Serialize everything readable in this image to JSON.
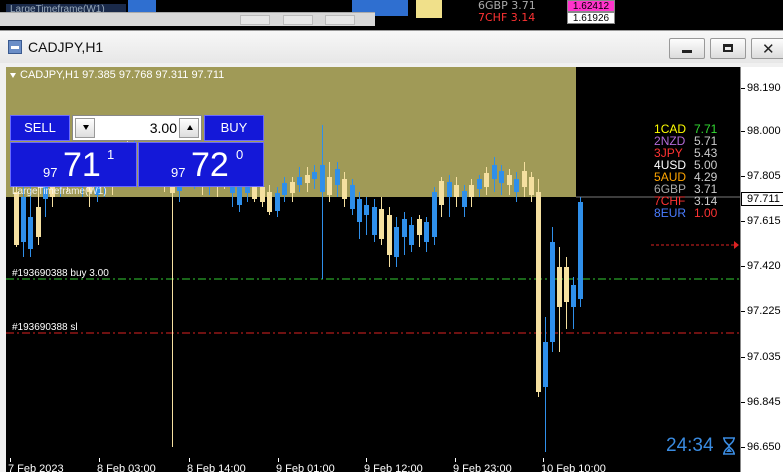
{
  "background_window": {
    "title_fragment": "LargeTimeframe(W1)",
    "rows": [
      {
        "text": "6GBP 3.71"
      },
      {
        "text": "7CHF 3.14"
      }
    ],
    "price_top": "1.62412",
    "price_bottom": "1.61926"
  },
  "window": {
    "title": "CADJPY,H1",
    "buttons": {
      "minimize": "",
      "maximize": "",
      "close": "✕"
    }
  },
  "chart": {
    "symbol_info": "CADJPY,H1  97.385 97.768 97.311 97.711",
    "indicator_label": "LargeTimeframe(W1)",
    "current_price": "97.711",
    "y_ticks": [
      "98.190",
      "98.000",
      "97.805",
      "97.615",
      "97.420",
      "97.225",
      "97.035",
      "96.845",
      "96.650"
    ],
    "x_labels": [
      "7 Feb 2023",
      "8 Feb 03:00",
      "8 Feb 14:00",
      "9 Feb 01:00",
      "9 Feb 12:00",
      "9 Feb 23:00",
      "10 Feb 10:00"
    ],
    "orders": [
      {
        "label": "#193690388 buy 3.00"
      },
      {
        "label": "#193690388 sl"
      }
    ],
    "timer": "24:34"
  },
  "one_click": {
    "sell_label": "SELL",
    "buy_label": "BUY",
    "lot": "3.00",
    "sell": {
      "prefix": "97",
      "big": "71",
      "sup": "1"
    },
    "buy": {
      "prefix": "97",
      "big": "72",
      "sup": "0"
    }
  },
  "strength": [
    {
      "rank": "1",
      "cur": "CAD",
      "val": "7.71",
      "cur_color": "#ffff00",
      "val_color": "#33dd33"
    },
    {
      "rank": "2",
      "cur": "NZD",
      "val": "5.71",
      "cur_color": "#b36bd8",
      "val_color": "#cccccc"
    },
    {
      "rank": "3",
      "cur": "JPY",
      "val": "5.43",
      "cur_color": "#ff3333",
      "val_color": "#cccccc"
    },
    {
      "rank": "4",
      "cur": "USD",
      "val": "5.00",
      "cur_color": "#ffffff",
      "val_color": "#cccccc"
    },
    {
      "rank": "5",
      "cur": "AUD",
      "val": "4.29",
      "cur_color": "#ffa500",
      "val_color": "#cccccc"
    },
    {
      "rank": "6",
      "cur": "GBP",
      "val": "3.71",
      "cur_color": "#aaaaaa",
      "val_color": "#cccccc"
    },
    {
      "rank": "7",
      "cur": "CHF",
      "val": "3.14",
      "cur_color": "#ff3333",
      "val_color": "#cccccc"
    },
    {
      "rank": "8",
      "cur": "EUR",
      "val": "1.00",
      "cur_color": "#4a7cff",
      "val_color": "#ff3333"
    }
  ],
  "colors": {
    "bull": "#2f8fea",
    "bear": "#f5e0a0",
    "zone": "#a09a57",
    "order_buy": "#33cc33",
    "order_sl": "#dd2222"
  }
}
